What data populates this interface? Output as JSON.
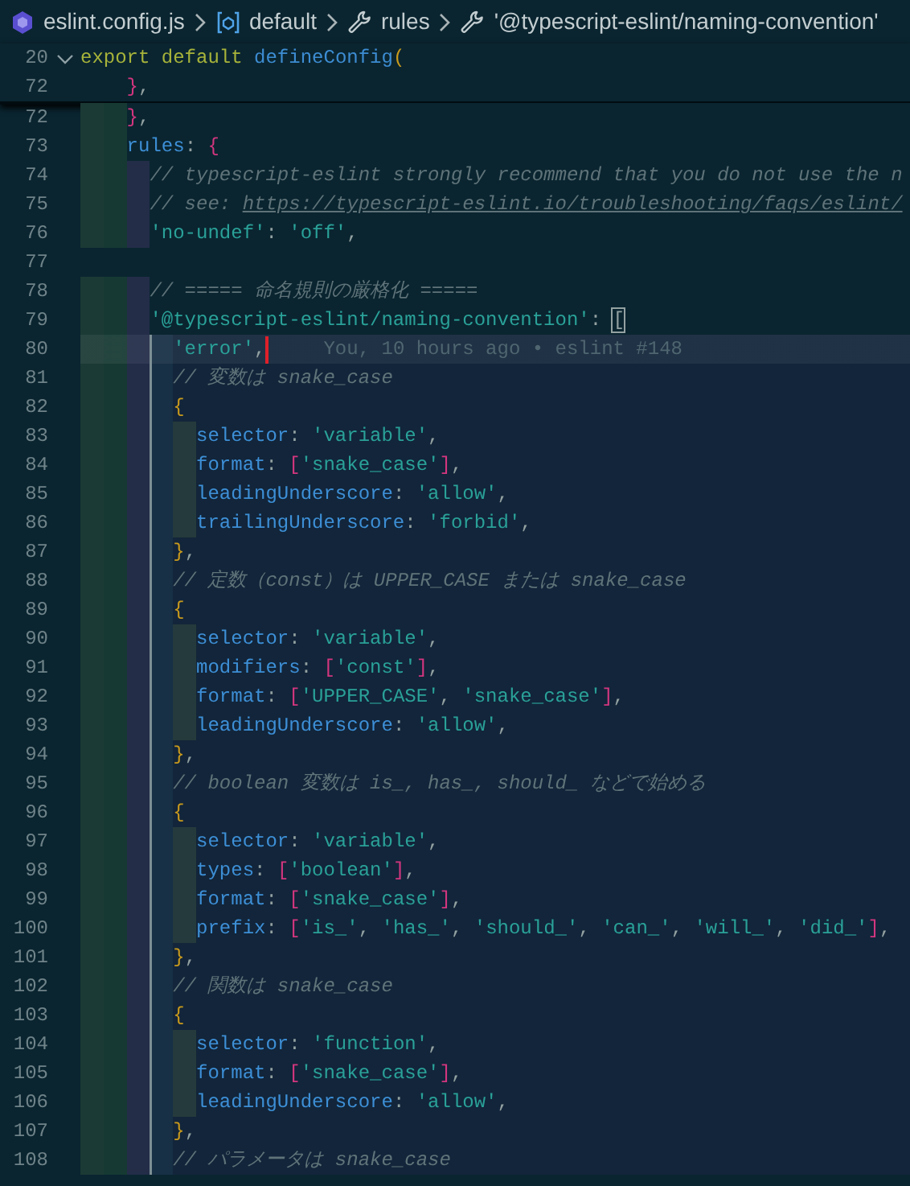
{
  "breadcrumb": [
    {
      "kind": "file",
      "label": "eslint.config.js"
    },
    {
      "kind": "variable",
      "label": "default"
    },
    {
      "kind": "property",
      "label": "rules"
    },
    {
      "kind": "property",
      "label": "'@typescript-eslint/naming-convention'"
    }
  ],
  "sticky_lines": [
    {
      "number": "20",
      "expanded": true,
      "tokens": [
        {
          "text": "export default ",
          "kind": "kw"
        },
        {
          "text": "defineConfig",
          "kind": "fn"
        },
        {
          "text": "(",
          "kind": "yellow"
        }
      ]
    },
    {
      "number": "72",
      "tokens": [
        {
          "text": "    }",
          "kind": "pink"
        },
        {
          "text": ",",
          "kind": "plain"
        }
      ]
    }
  ],
  "lines": [
    {
      "number": "72",
      "in_scope": false,
      "current": false,
      "tokens": [
        {
          "text": "    }",
          "kind": "pink"
        },
        {
          "text": ",",
          "kind": "plain"
        }
      ]
    },
    {
      "number": "73",
      "in_scope": false,
      "current": false,
      "tokens": [
        {
          "text": "    rules",
          "kind": "key"
        },
        {
          "text": ": ",
          "kind": "plain"
        },
        {
          "text": "{",
          "kind": "pink"
        }
      ]
    },
    {
      "number": "74",
      "in_scope": false,
      "current": false,
      "tokens": [
        {
          "text": "      // typescript-eslint strongly recommend that you do not use the n",
          "kind": "com"
        }
      ]
    },
    {
      "number": "75",
      "in_scope": false,
      "current": false,
      "tokens": [
        {
          "text": "      // see: ",
          "kind": "com"
        },
        {
          "text": "https://typescript-eslint.io/troubleshooting/faqs/eslint/",
          "kind": "link"
        }
      ]
    },
    {
      "number": "76",
      "in_scope": false,
      "current": false,
      "tokens": [
        {
          "text": "      'no-undef'",
          "kind": "str"
        },
        {
          "text": ": ",
          "kind": "plain"
        },
        {
          "text": "'off'",
          "kind": "str"
        },
        {
          "text": ",",
          "kind": "plain"
        }
      ]
    },
    {
      "number": "77",
      "in_scope": false,
      "current": false
    },
    {
      "number": "78",
      "in_scope": false,
      "current": false,
      "tokens": [
        {
          "text": "      // ===== 命名規則の厳格化 =====",
          "kind": "com"
        }
      ]
    },
    {
      "number": "79",
      "in_scope": false,
      "current": false,
      "tokens": [
        {
          "text": "      '@typescript-eslint/naming-convention'",
          "kind": "str"
        },
        {
          "text": ": ",
          "kind": "plain"
        },
        {
          "text": "[",
          "kind": "match"
        }
      ]
    },
    {
      "number": "80",
      "in_scope": true,
      "current": true,
      "tokens": [
        {
          "text": "        'error'",
          "kind": "str"
        },
        {
          "text": ",",
          "kind": "plain"
        }
      ],
      "blame": "You, 10 hours ago • eslint #148"
    },
    {
      "number": "81",
      "in_scope": true,
      "current": false,
      "tokens": [
        {
          "text": "        // 変数は snake_case",
          "kind": "com"
        }
      ]
    },
    {
      "number": "82",
      "in_scope": true,
      "current": false,
      "tokens": [
        {
          "text": "        {",
          "kind": "yellow"
        }
      ]
    },
    {
      "number": "83",
      "in_scope": true,
      "current": false,
      "tokens": [
        {
          "text": "          selector",
          "kind": "key"
        },
        {
          "text": ": ",
          "kind": "plain"
        },
        {
          "text": "'variable'",
          "kind": "str"
        },
        {
          "text": ",",
          "kind": "plain"
        }
      ]
    },
    {
      "number": "84",
      "in_scope": true,
      "current": false,
      "tokens": [
        {
          "text": "          format",
          "kind": "key"
        },
        {
          "text": ": ",
          "kind": "plain"
        },
        {
          "text": "[",
          "kind": "pink"
        },
        {
          "text": "'snake_case'",
          "kind": "str"
        },
        {
          "text": "]",
          "kind": "pink"
        },
        {
          "text": ",",
          "kind": "plain"
        }
      ]
    },
    {
      "number": "85",
      "in_scope": true,
      "current": false,
      "tokens": [
        {
          "text": "          leadingUnderscore",
          "kind": "key"
        },
        {
          "text": ": ",
          "kind": "plain"
        },
        {
          "text": "'allow'",
          "kind": "str"
        },
        {
          "text": ",",
          "kind": "plain"
        }
      ]
    },
    {
      "number": "86",
      "in_scope": true,
      "current": false,
      "tokens": [
        {
          "text": "          trailingUnderscore",
          "kind": "key"
        },
        {
          "text": ": ",
          "kind": "plain"
        },
        {
          "text": "'forbid'",
          "kind": "str"
        },
        {
          "text": ",",
          "kind": "plain"
        }
      ]
    },
    {
      "number": "87",
      "in_scope": true,
      "current": false,
      "tokens": [
        {
          "text": "        }",
          "kind": "yellow"
        },
        {
          "text": ",",
          "kind": "plain"
        }
      ]
    },
    {
      "number": "88",
      "in_scope": true,
      "current": false,
      "tokens": [
        {
          "text": "        // 定数（const）は UPPER_CASE または snake_case",
          "kind": "com"
        }
      ]
    },
    {
      "number": "89",
      "in_scope": true,
      "current": false,
      "tokens": [
        {
          "text": "        {",
          "kind": "yellow"
        }
      ]
    },
    {
      "number": "90",
      "in_scope": true,
      "current": false,
      "tokens": [
        {
          "text": "          selector",
          "kind": "key"
        },
        {
          "text": ": ",
          "kind": "plain"
        },
        {
          "text": "'variable'",
          "kind": "str"
        },
        {
          "text": ",",
          "kind": "plain"
        }
      ]
    },
    {
      "number": "91",
      "in_scope": true,
      "current": false,
      "tokens": [
        {
          "text": "          modifiers",
          "kind": "key"
        },
        {
          "text": ": ",
          "kind": "plain"
        },
        {
          "text": "[",
          "kind": "pink"
        },
        {
          "text": "'const'",
          "kind": "str"
        },
        {
          "text": "]",
          "kind": "pink"
        },
        {
          "text": ",",
          "kind": "plain"
        }
      ]
    },
    {
      "number": "92",
      "in_scope": true,
      "current": false,
      "tokens": [
        {
          "text": "          format",
          "kind": "key"
        },
        {
          "text": ": ",
          "kind": "plain"
        },
        {
          "text": "[",
          "kind": "pink"
        },
        {
          "text": "'UPPER_CASE'",
          "kind": "str"
        },
        {
          "text": ", ",
          "kind": "plain"
        },
        {
          "text": "'snake_case'",
          "kind": "str"
        },
        {
          "text": "]",
          "kind": "pink"
        },
        {
          "text": ",",
          "kind": "plain"
        }
      ]
    },
    {
      "number": "93",
      "in_scope": true,
      "current": false,
      "tokens": [
        {
          "text": "          leadingUnderscore",
          "kind": "key"
        },
        {
          "text": ": ",
          "kind": "plain"
        },
        {
          "text": "'allow'",
          "kind": "str"
        },
        {
          "text": ",",
          "kind": "plain"
        }
      ]
    },
    {
      "number": "94",
      "in_scope": true,
      "current": false,
      "tokens": [
        {
          "text": "        }",
          "kind": "yellow"
        },
        {
          "text": ",",
          "kind": "plain"
        }
      ]
    },
    {
      "number": "95",
      "in_scope": true,
      "current": false,
      "tokens": [
        {
          "text": "        // boolean 変数は is_, has_, should_ などで始める",
          "kind": "com"
        }
      ]
    },
    {
      "number": "96",
      "in_scope": true,
      "current": false,
      "tokens": [
        {
          "text": "        {",
          "kind": "yellow"
        }
      ]
    },
    {
      "number": "97",
      "in_scope": true,
      "current": false,
      "tokens": [
        {
          "text": "          selector",
          "kind": "key"
        },
        {
          "text": ": ",
          "kind": "plain"
        },
        {
          "text": "'variable'",
          "kind": "str"
        },
        {
          "text": ",",
          "kind": "plain"
        }
      ]
    },
    {
      "number": "98",
      "in_scope": true,
      "current": false,
      "tokens": [
        {
          "text": "          types",
          "kind": "key"
        },
        {
          "text": ": ",
          "kind": "plain"
        },
        {
          "text": "[",
          "kind": "pink"
        },
        {
          "text": "'boolean'",
          "kind": "str"
        },
        {
          "text": "]",
          "kind": "pink"
        },
        {
          "text": ",",
          "kind": "plain"
        }
      ]
    },
    {
      "number": "99",
      "in_scope": true,
      "current": false,
      "tokens": [
        {
          "text": "          format",
          "kind": "key"
        },
        {
          "text": ": ",
          "kind": "plain"
        },
        {
          "text": "[",
          "kind": "pink"
        },
        {
          "text": "'snake_case'",
          "kind": "str"
        },
        {
          "text": "]",
          "kind": "pink"
        },
        {
          "text": ",",
          "kind": "plain"
        }
      ]
    },
    {
      "number": "100",
      "in_scope": true,
      "current": false,
      "tokens": [
        {
          "text": "          prefix",
          "kind": "key"
        },
        {
          "text": ": ",
          "kind": "plain"
        },
        {
          "text": "[",
          "kind": "pink"
        },
        {
          "text": "'is_'",
          "kind": "str"
        },
        {
          "text": ", ",
          "kind": "plain"
        },
        {
          "text": "'has_'",
          "kind": "str"
        },
        {
          "text": ", ",
          "kind": "plain"
        },
        {
          "text": "'should_'",
          "kind": "str"
        },
        {
          "text": ", ",
          "kind": "plain"
        },
        {
          "text": "'can_'",
          "kind": "str"
        },
        {
          "text": ", ",
          "kind": "plain"
        },
        {
          "text": "'will_'",
          "kind": "str"
        },
        {
          "text": ", ",
          "kind": "plain"
        },
        {
          "text": "'did_'",
          "kind": "str"
        },
        {
          "text": "]",
          "kind": "pink"
        },
        {
          "text": ",",
          "kind": "plain"
        }
      ]
    },
    {
      "number": "101",
      "in_scope": true,
      "current": false,
      "tokens": [
        {
          "text": "        }",
          "kind": "yellow"
        },
        {
          "text": ",",
          "kind": "plain"
        }
      ]
    },
    {
      "number": "102",
      "in_scope": true,
      "current": false,
      "tokens": [
        {
          "text": "        // 関数は snake_case",
          "kind": "com"
        }
      ]
    },
    {
      "number": "103",
      "in_scope": true,
      "current": false,
      "tokens": [
        {
          "text": "        {",
          "kind": "yellow"
        }
      ]
    },
    {
      "number": "104",
      "in_scope": true,
      "current": false,
      "tokens": [
        {
          "text": "          selector",
          "kind": "key"
        },
        {
          "text": ": ",
          "kind": "plain"
        },
        {
          "text": "'function'",
          "kind": "str"
        },
        {
          "text": ",",
          "kind": "plain"
        }
      ]
    },
    {
      "number": "105",
      "in_scope": true,
      "current": false,
      "tokens": [
        {
          "text": "          format",
          "kind": "key"
        },
        {
          "text": ": ",
          "kind": "plain"
        },
        {
          "text": "[",
          "kind": "pink"
        },
        {
          "text": "'snake_case'",
          "kind": "str"
        },
        {
          "text": "]",
          "kind": "pink"
        },
        {
          "text": ",",
          "kind": "plain"
        }
      ]
    },
    {
      "number": "106",
      "in_scope": true,
      "current": false,
      "tokens": [
        {
          "text": "          leadingUnderscore",
          "kind": "key"
        },
        {
          "text": ": ",
          "kind": "plain"
        },
        {
          "text": "'allow'",
          "kind": "str"
        },
        {
          "text": ",",
          "kind": "plain"
        }
      ]
    },
    {
      "number": "107",
      "in_scope": true,
      "current": false,
      "tokens": [
        {
          "text": "        }",
          "kind": "yellow"
        },
        {
          "text": ",",
          "kind": "plain"
        }
      ]
    },
    {
      "number": "108",
      "in_scope": true,
      "current": false,
      "tokens": [
        {
          "text": "        // パラメータは snake_case",
          "kind": "com"
        }
      ]
    }
  ]
}
